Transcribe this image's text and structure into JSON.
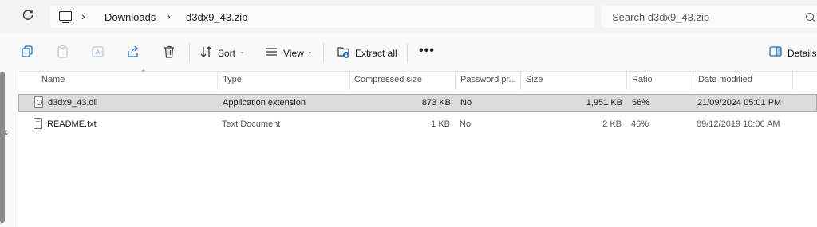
{
  "address_bar": {
    "breadcrumbs": [
      "Downloads",
      "d3dx9_43.zip"
    ],
    "search_placeholder": "Search d3dx9_43.zip"
  },
  "toolbar": {
    "sort_label": "Sort",
    "view_label": "View",
    "extract_label": "Extract all",
    "more_label": "•••",
    "details_label": "Details"
  },
  "nav_fragments": [
    "sc"
  ],
  "columns": [
    "Name",
    "Type",
    "Compressed size",
    "Password pr...",
    "Size",
    "Ratio",
    "Date modified"
  ],
  "files": [
    {
      "name": "d3dx9_43.dll",
      "type": "Application extension",
      "compressed_size": "873 KB",
      "password": "No",
      "size": "1,951 KB",
      "ratio": "56%",
      "date_modified": "21/09/2024 05:01 PM",
      "icon": "dll-file-icon",
      "selected": true
    },
    {
      "name": "README.txt",
      "type": "Text Document",
      "compressed_size": "1 KB",
      "password": "No",
      "size": "2 KB",
      "ratio": "46%",
      "date_modified": "09/12/2019 10:06 AM",
      "icon": "text-file-icon",
      "selected": false
    }
  ]
}
